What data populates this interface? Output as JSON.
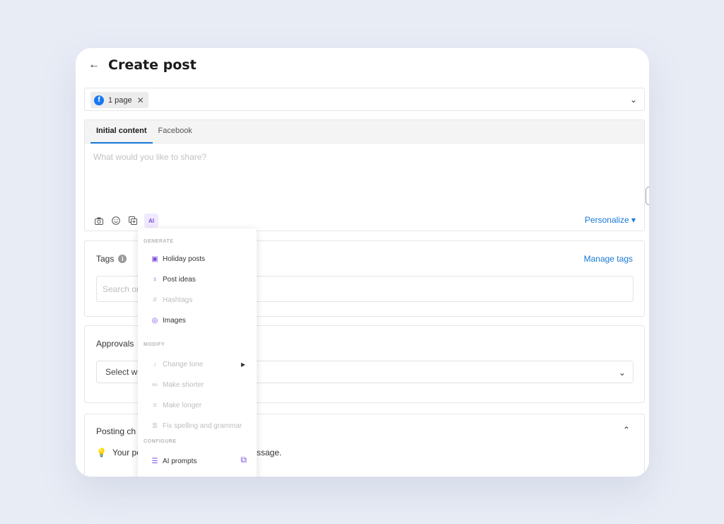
{
  "header": {
    "back_icon": "arrow-left-icon",
    "title": "Create post"
  },
  "pages": {
    "chip_label": "1 page",
    "chip_icon": "facebook-icon"
  },
  "editor": {
    "tabs": [
      {
        "label": "Initial content"
      },
      {
        "label": "Facebook"
      }
    ],
    "placeholder": "What would you like to share?",
    "tool_icons": [
      "camera-icon",
      "emoji-icon",
      "media-library-icon",
      "ai-assistant-icon"
    ],
    "personalize_label": "Personalize ▾"
  },
  "tags": {
    "label": "Tags",
    "manage_label": "Manage tags",
    "search_placeholder": "Search or"
  },
  "approvals": {
    "label": "Approvals",
    "select_placeholder": "Select w"
  },
  "posting": {
    "label": "Posting ch",
    "tip_start": "Your po",
    "tip_end": "ssage."
  },
  "ai_menu": {
    "generate_heading": "GENERATE",
    "modify_heading": "MODIFY",
    "configure_heading": "CONFIGURE",
    "items": [
      {
        "label": "Holiday posts",
        "icon": "calendar-icon",
        "enabled": true
      },
      {
        "label": "Post ideas",
        "icon": "lightbulb-icon",
        "enabled": true
      },
      {
        "label": "Hashtags",
        "icon": "hashtag-icon",
        "enabled": false
      },
      {
        "label": "Images",
        "icon": "image-icon",
        "enabled": true
      },
      {
        "label": "Change tone",
        "icon": "tone-icon",
        "enabled": false
      },
      {
        "label": "Make shorter",
        "icon": "shorter-icon",
        "enabled": false
      },
      {
        "label": "Make longer",
        "icon": "longer-icon",
        "enabled": false
      },
      {
        "label": "Fix spelling and grammar",
        "icon": "spellcheck-icon",
        "enabled": false
      },
      {
        "label": "AI prompts",
        "icon": "prompts-icon",
        "enabled": true
      }
    ]
  },
  "colors": {
    "accent": "#1779d6",
    "ai_purple": "#7b4cdb",
    "background": "#e8ecf5"
  }
}
